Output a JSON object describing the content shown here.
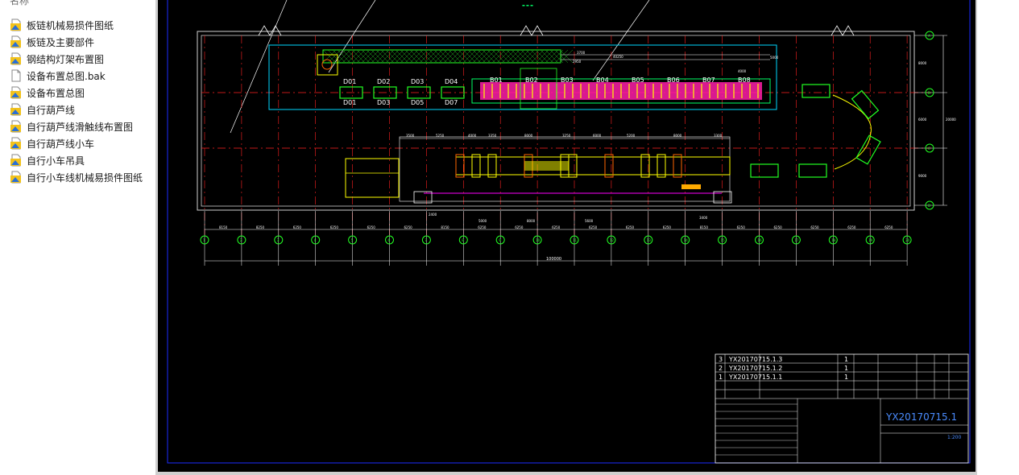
{
  "file_list": {
    "column_header": "名称",
    "items": [
      {
        "name": "板链机械易损件图纸",
        "icon": "dwg-file-icon"
      },
      {
        "name": "板链及主要部件",
        "icon": "dwg-file-icon"
      },
      {
        "name": "钢结构灯架布置图",
        "icon": "dwg-file-icon"
      },
      {
        "name": "设备布置总图.bak",
        "icon": "blank-file-icon"
      },
      {
        "name": "设备布置总图",
        "icon": "dwg-file-icon"
      },
      {
        "name": "自行葫芦线",
        "icon": "dwg-file-icon"
      },
      {
        "name": "自行葫芦线滑触线布置图",
        "icon": "dwg-file-icon"
      },
      {
        "name": "自行葫芦线小车",
        "icon": "dwg-file-icon"
      },
      {
        "name": "自行小车吊具",
        "icon": "dwg-file-icon"
      },
      {
        "name": "自行小车线机械易损件图纸",
        "icon": "dwg-file-icon"
      }
    ]
  },
  "drawing": {
    "upper_stations": [
      "D01",
      "D02",
      "D03",
      "D04"
    ],
    "lower_stations": [
      "D01",
      "D03",
      "D05",
      "D07"
    ],
    "chain_stations": [
      "B01",
      "B02",
      "B03",
      "B04",
      "B05",
      "B06",
      "B07",
      "B08"
    ],
    "upper_dims": [
      "3700",
      "40250",
      "4000",
      "5000",
      "2950"
    ],
    "lower_dims": [
      "3500",
      "5250",
      "4000",
      "3350",
      "8000",
      "3250",
      "6000",
      "5200",
      "8000",
      "3300"
    ],
    "lower_sub_dims": [
      "5000",
      "8000",
      "5600",
      "2400",
      "3400"
    ],
    "grid_dims": [
      "8150",
      "8250",
      "6250",
      "6250",
      "6250",
      "6250",
      "8150",
      "6250",
      "6250",
      "6250",
      "6250",
      "6250",
      "6250",
      "8150",
      "6250",
      "6250",
      "6250",
      "6250",
      "6250",
      "6250",
      "8250"
    ],
    "total_length": "100000",
    "right_dims": [
      "8000",
      "6000",
      "9000"
    ],
    "right_total": "20000",
    "axis_labels_bottom": [
      "1",
      "2",
      "3",
      "4",
      "5",
      "6",
      "7",
      "8",
      "9",
      "10",
      "11",
      "12",
      "13",
      "14",
      "15",
      "16",
      "17",
      "18",
      "19",
      "20"
    ],
    "axis_labels_right": [
      "A",
      "B",
      "C",
      "D"
    ],
    "title_block": {
      "parts": [
        {
          "no": "3",
          "code": "YX20170715.1.3",
          "qty": "1"
        },
        {
          "no": "2",
          "code": "YX20170715.1.2",
          "qty": "1"
        },
        {
          "no": "1",
          "code": "YX20170715.1.1",
          "qty": "1"
        }
      ],
      "drawing_no": "YX20170715.1",
      "scale": "1:200"
    }
  }
}
